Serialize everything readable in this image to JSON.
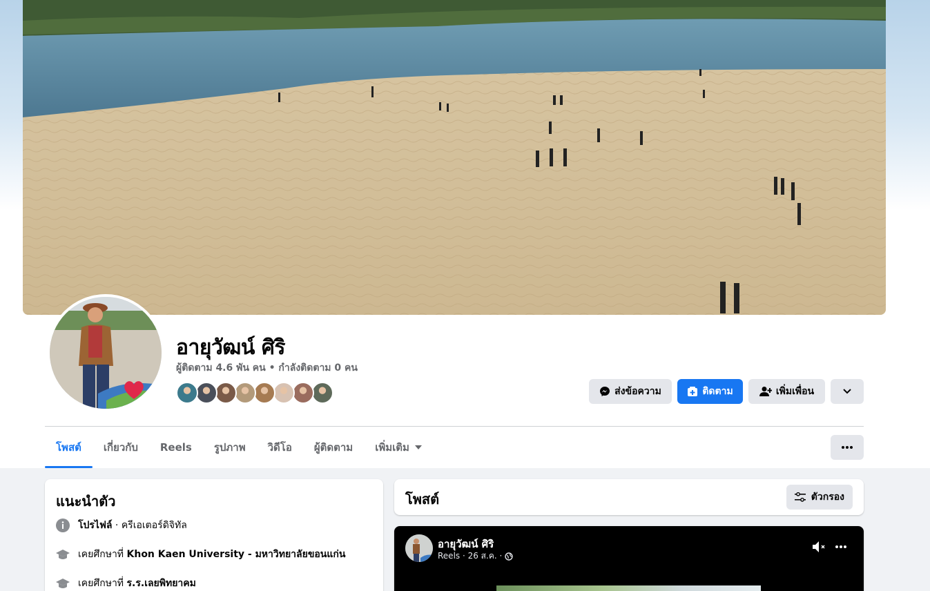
{
  "profile": {
    "name": "อายุวัฒน์ ศิริ",
    "stats": "ผู้ติดตาม 4.6 พัน คน • กำลังติดตาม 0 คน"
  },
  "actions": {
    "message": "ส่งข้อความ",
    "follow": "ติดตาม",
    "add_friend": "เพิ่มเพื่อน"
  },
  "tabs": [
    {
      "label": "โพสต์",
      "active": true
    },
    {
      "label": "เกี่ยวกับ",
      "active": false
    },
    {
      "label": "Reels",
      "active": false
    },
    {
      "label": "รูปภาพ",
      "active": false
    },
    {
      "label": "วิดีโอ",
      "active": false
    },
    {
      "label": "ผู้ติดตาม",
      "active": false
    },
    {
      "label": "เพิ่มเติม",
      "active": false
    }
  ],
  "intro": {
    "title": "แนะนำตัว",
    "profile_label": "โปรไฟล์",
    "profile_value": " · ครีเอเตอร์ดิจิทัล",
    "edu1_prefix": "เคยศึกษาที่ ",
    "edu1_value": "Khon Kaen University - มหาวิทยาลัยขอนแก่น",
    "edu2_prefix": "เคยศึกษาที่ ",
    "edu2_value": "ร.ร.เลยพิทยาคม"
  },
  "posts": {
    "title": "โพสต์",
    "filter_label": "ตัวกรอง"
  },
  "reel_post": {
    "author": "อายุวัฒน์ ศิริ",
    "meta": "Reels · 26 ส.ค. ·"
  },
  "colors": {
    "accent": "#1877f2",
    "button_gray": "#e4e6eb",
    "secondary_text": "#65676b"
  },
  "friend_avatar_colors": [
    "#3c7a8c",
    "#4a4f5a",
    "#7a5a48",
    "#b39a7a",
    "#a67b52",
    "#d8c2b2",
    "#9a6c5e",
    "#5e6a5a"
  ]
}
